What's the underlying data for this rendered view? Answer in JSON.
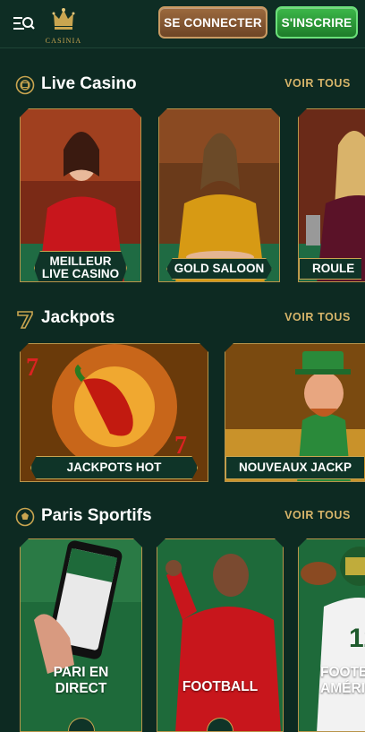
{
  "header": {
    "logo_text": "CASINIA",
    "login_label": "SE CONNECTER",
    "signup_label": "S'INSCRIRE"
  },
  "sections": [
    {
      "title": "Live Casino",
      "see_all": "VOIR TOUS",
      "cards": [
        {
          "label_line1": "MEILLEUR",
          "label_line2": "LIVE CASINO"
        },
        {
          "label_line1": "GOLD SALOON",
          "label_line2": ""
        },
        {
          "label_line1": "ROULE",
          "label_line2": ""
        }
      ]
    },
    {
      "title": "Jackpots",
      "see_all": "VOIR TOUS",
      "cards": [
        {
          "label_line1": "JACKPOTS HOT"
        },
        {
          "label_line1": "NOUVEAUX JACKP"
        }
      ]
    },
    {
      "title": "Paris Sportifs",
      "see_all": "VOIR TOUS",
      "cards": [
        {
          "label_line1": "PARI EN",
          "label_line2": "DIRECT"
        },
        {
          "label_line1": "FOOTBALL",
          "label_line2": ""
        },
        {
          "label_line1": "FOOTB",
          "label_line2": "AMÉRI"
        }
      ]
    }
  ],
  "colors": {
    "background": "#0d2a22",
    "gold": "#c9a550",
    "login_brown": "#8a5a33",
    "signup_green": "#2aa23a"
  },
  "icons": [
    "menu-search-icon",
    "crown-logo-icon",
    "live-casino-chip-icon",
    "seven-icon",
    "football-icon"
  ]
}
